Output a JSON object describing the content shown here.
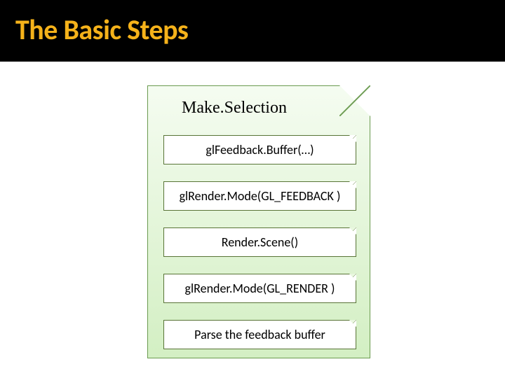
{
  "title": "The Basic Steps",
  "panel": {
    "heading": "Make.Selection",
    "steps": [
      "glFeedback.Buffer(…)",
      "glRender.Mode(GL_FEEDBACK )",
      "Render.Scene()",
      "glRender.Mode(GL_RENDER )",
      "Parse the feedback buffer"
    ]
  }
}
